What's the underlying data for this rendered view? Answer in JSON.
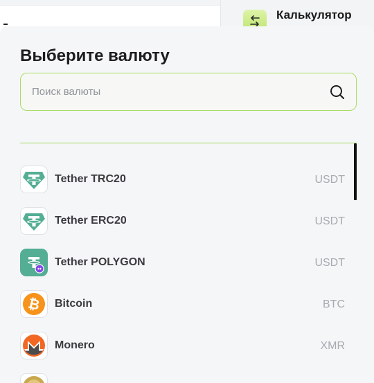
{
  "background": {
    "calculator_title": "Калькулятор"
  },
  "modal": {
    "title": "Выберите валюту",
    "search": {
      "placeholder": "Поиск валюты",
      "value": ""
    }
  },
  "currencies": [
    {
      "name": "Tether TRC20",
      "ticker": "USDT",
      "icon": "tether-icon"
    },
    {
      "name": "Tether ERC20",
      "ticker": "USDT",
      "icon": "tether-icon"
    },
    {
      "name": "Tether POLYGON",
      "ticker": "USDT",
      "icon": "tether-polygon-icon"
    },
    {
      "name": "Bitcoin",
      "ticker": "BTC",
      "icon": "bitcoin-icon"
    },
    {
      "name": "Monero",
      "ticker": "XMR",
      "icon": "monero-icon"
    }
  ],
  "colors": {
    "accent_green": "#a8dc62",
    "tether": "#53ae94",
    "bitcoin": "#f7931a",
    "monero": "#f26822"
  }
}
